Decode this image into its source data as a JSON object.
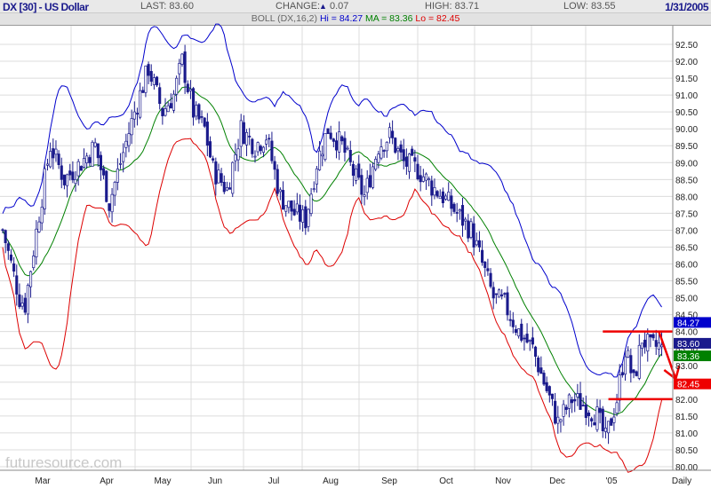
{
  "header": {
    "title": "DX [30] - US Dollar",
    "last": "LAST: 83.60",
    "change_label": "CHANGE:",
    "change_icon": "triangle-up-icon",
    "change_value": "0.07",
    "high": "HIGH: 83.71",
    "low": "LOW: 83.55",
    "date": "1/31/2005"
  },
  "indicator": {
    "name": "BOLL (DX,16,2)",
    "hi": "Hi = 84.27",
    "ma": "MA = 83.36",
    "lo": "Lo = 82.45"
  },
  "watermark": "futuresource.com",
  "colors": {
    "candle": "#1a1a8c",
    "upper": "#0000cc",
    "middle": "#008000",
    "lower": "#dd0000",
    "annotation": "#ee0000"
  },
  "chart_data": {
    "type": "candlestick",
    "title": "DX [30] - US Dollar",
    "xlabel": "",
    "ylabel": "",
    "ylim": [
      79.8,
      93.0
    ],
    "yticks": [
      "80.00",
      "80.50",
      "81.00",
      "81.50",
      "82.00",
      "82.50",
      "83.00",
      "83.50",
      "84.00",
      "84.50",
      "85.00",
      "85.50",
      "86.00",
      "86.50",
      "87.00",
      "87.50",
      "88.00",
      "88.50",
      "89.00",
      "89.50",
      "90.00",
      "90.50",
      "91.00",
      "91.50",
      "92.00",
      "92.50"
    ],
    "xticks": [
      "Mar",
      "Apr",
      "May",
      "Jun",
      "Jul",
      "Aug",
      "Sep",
      "Oct",
      "Nov",
      "Dec",
      "'05",
      "Daily"
    ],
    "x_unit": "trading day index",
    "xlim": [
      0,
      238
    ],
    "closes_approx": [
      [
        0,
        87.0
      ],
      [
        6,
        85.0
      ],
      [
        8,
        84.8
      ],
      [
        13,
        87.5
      ],
      [
        17,
        89.5
      ],
      [
        22,
        88.5
      ],
      [
        28,
        89.0
      ],
      [
        33,
        89.5
      ],
      [
        38,
        87.8
      ],
      [
        42,
        89.0
      ],
      [
        47,
        90.5
      ],
      [
        52,
        91.8
      ],
      [
        57,
        90.5
      ],
      [
        61,
        91.0
      ],
      [
        64,
        92.0
      ],
      [
        68,
        90.5
      ],
      [
        72,
        90.0
      ],
      [
        75,
        88.8
      ],
      [
        80,
        88.2
      ],
      [
        85,
        90.0
      ],
      [
        90,
        89.5
      ],
      [
        94,
        89.8
      ],
      [
        99,
        88.0
      ],
      [
        104,
        87.5
      ],
      [
        108,
        87.3
      ],
      [
        112,
        89.0
      ],
      [
        116,
        90.0
      ],
      [
        121,
        89.5
      ],
      [
        126,
        88.5
      ],
      [
        129,
        88.0
      ],
      [
        134,
        89.5
      ],
      [
        138,
        89.8
      ],
      [
        143,
        89.0
      ],
      [
        148,
        88.8
      ],
      [
        153,
        88.3
      ],
      [
        157,
        88.0
      ],
      [
        162,
        87.5
      ],
      [
        167,
        87.0
      ],
      [
        171,
        86.0
      ],
      [
        175,
        85.0
      ],
      [
        179,
        84.8
      ],
      [
        184,
        84.0
      ],
      [
        189,
        83.5
      ],
      [
        193,
        82.5
      ],
      [
        198,
        81.3
      ],
      [
        203,
        82.0
      ],
      [
        208,
        81.8
      ],
      [
        212,
        81.5
      ],
      [
        215,
        80.8
      ],
      [
        219,
        82.0
      ],
      [
        222,
        83.5
      ],
      [
        225,
        82.5
      ],
      [
        228,
        83.8
      ],
      [
        231,
        83.5
      ],
      [
        235,
        83.6
      ]
    ],
    "bollinger": {
      "period": 16,
      "stddev": 2,
      "hi": 84.27,
      "ma": 83.36,
      "lo": 82.45
    },
    "last": 83.6,
    "value_labels": {
      "hi": "84.27",
      "last": "83.60",
      "ma": "83.36",
      "lo": "82.45"
    },
    "annotations": [
      {
        "type": "hline",
        "y": 84.0,
        "from_day": 214
      },
      {
        "type": "hline",
        "y": 82.0,
        "from_day": 216
      },
      {
        "type": "arrow",
        "from": [
          234,
          84.0
        ],
        "to": [
          240,
          82.6
        ]
      }
    ]
  }
}
